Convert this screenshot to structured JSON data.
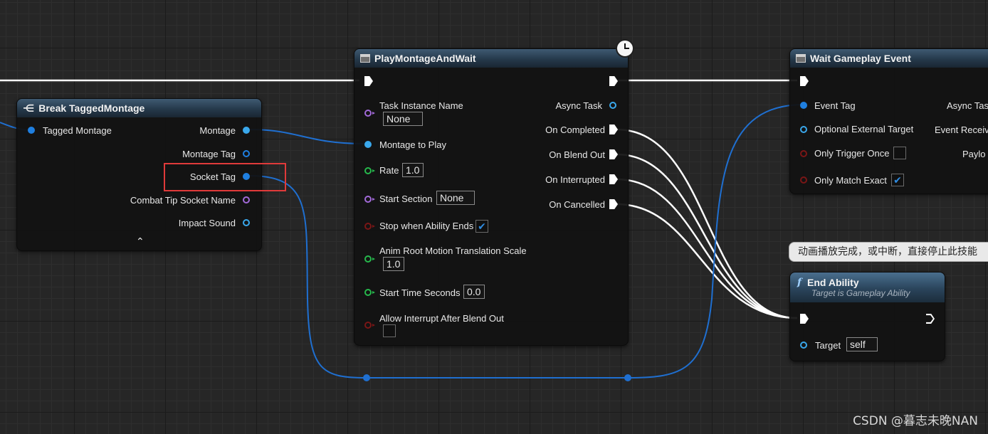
{
  "break_node": {
    "title": "Break TaggedMontage",
    "input": "Tagged Montage",
    "outputs": [
      "Montage",
      "Montage Tag",
      "Socket Tag",
      "Combat Tip Socket Name",
      "Impact Sound"
    ],
    "collapse_icon": "chevron-up-icon"
  },
  "play_node": {
    "title": "PlayMontageAndWait",
    "latent_icon": "clock-icon",
    "inputs": {
      "task_instance_name": "Task Instance Name",
      "task_instance_value": "None",
      "montage_to_play": "Montage to Play",
      "rate": "Rate",
      "rate_value": "1.0",
      "start_section": "Start Section",
      "start_section_value": "None",
      "stop_when_ability_ends": "Stop when Ability Ends",
      "stop_when_ability_ends_checked": true,
      "anim_root_motion": "Anim Root Motion Translation Scale",
      "anim_root_motion_value": "1.0",
      "start_time_seconds": "Start Time Seconds",
      "start_time_seconds_value": "0.0",
      "allow_interrupt": "Allow Interrupt After Blend Out",
      "allow_interrupt_checked": false
    },
    "outputs": {
      "async_task": "Async Task",
      "on_completed": "On Completed",
      "on_blend_out": "On Blend Out",
      "on_interrupted": "On Interrupted",
      "on_cancelled": "On Cancelled"
    }
  },
  "wait_node": {
    "title": "Wait Gameplay Event",
    "inputs": {
      "event_tag": "Event Tag",
      "optional_external_target": "Optional External Target",
      "only_trigger_once": "Only Trigger Once",
      "only_trigger_once_checked": false,
      "only_match_exact": "Only Match Exact",
      "only_match_exact_checked": true
    },
    "outputs": {
      "async_task": "Async Tas",
      "event_received": "Event Receiv",
      "payload": "Paylo"
    }
  },
  "comment": {
    "text": "动画播放完成，或中断，直接停止此技能"
  },
  "end_node": {
    "title": "End Ability",
    "subtitle": "Target is Gameplay Ability",
    "target_label": "Target",
    "target_value": "self"
  },
  "watermark": "CSDN @暮志未晚NAN",
  "colors": {
    "background": "#262626",
    "exec_wire": "#ffffff",
    "data_wire": "#1f6fd0",
    "highlight": "#e03a3a"
  }
}
